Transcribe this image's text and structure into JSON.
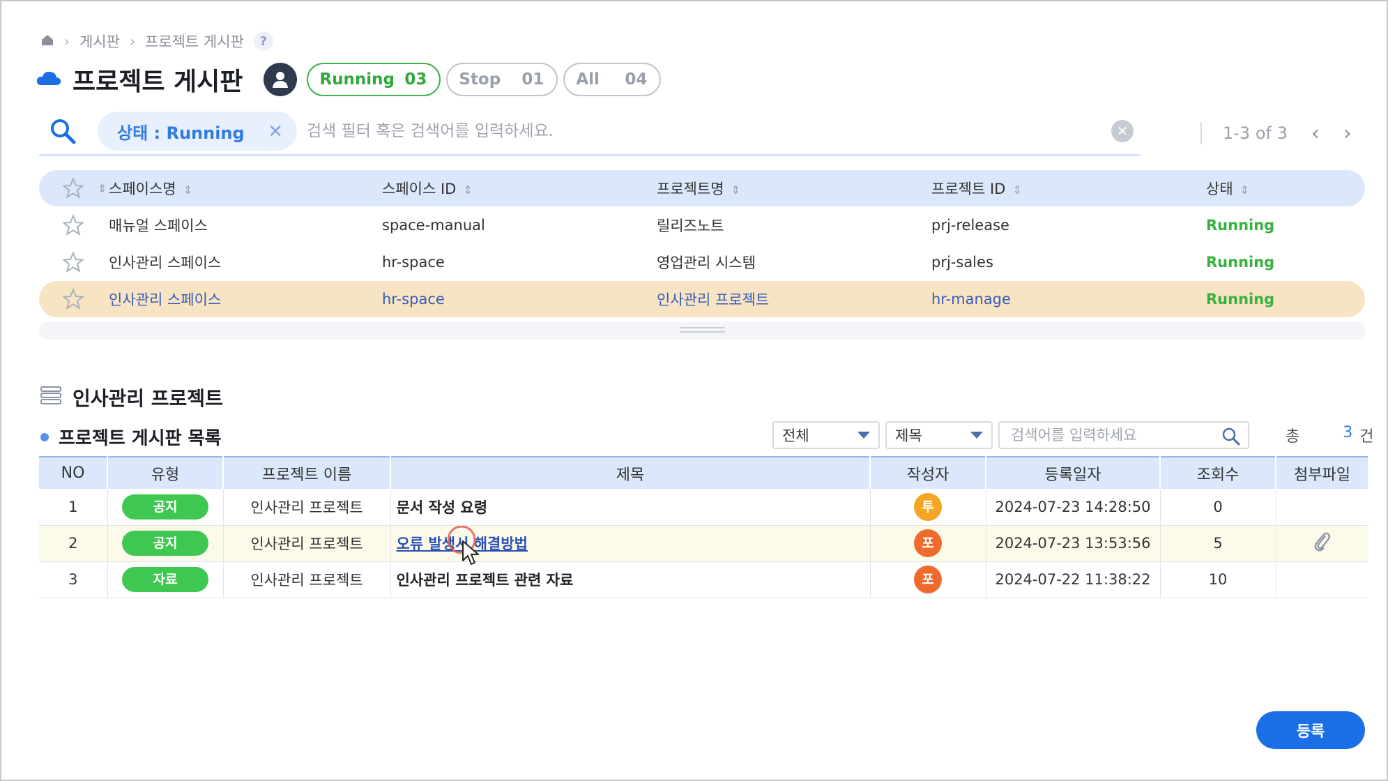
{
  "breadcrumb": {
    "items": [
      "게시판",
      "프로젝트 게시판"
    ],
    "help": "?"
  },
  "header": {
    "title": "프로젝트 게시판",
    "filters": [
      {
        "label": "Running",
        "count": "03"
      },
      {
        "label": "Stop",
        "count": "01"
      },
      {
        "label": "All",
        "count": "04"
      }
    ]
  },
  "search": {
    "chip": "상태 : Running",
    "placeholder": "검색 필터 혹은 검색어를 입력하세요.",
    "pager": "1-3 of 3"
  },
  "space_table": {
    "columns": [
      "스페이스명",
      "스페이스 ID",
      "프로젝트명",
      "프로젝트 ID",
      "상태"
    ],
    "rows": [
      [
        "매뉴얼 스페이스",
        "space-manual",
        "릴리즈노트",
        "prj-release",
        "Running"
      ],
      [
        "인사관리 스페이스",
        "hr-space",
        "영업관리 시스템",
        "prj-sales",
        "Running"
      ],
      [
        "인사관리 스페이스",
        "hr-space",
        "인사관리 프로젝트",
        "hr-manage",
        "Running"
      ]
    ]
  },
  "section": {
    "title": "인사관리 프로젝트",
    "subtitle": "프로젝트 게시판 목록"
  },
  "toolbar": {
    "select1": "전체",
    "select2": "제목",
    "search_placeholder": "검색어를 입력하세요",
    "total_label": "총",
    "total_count": "3",
    "total_unit": "건"
  },
  "board": {
    "columns": [
      "NO",
      "유형",
      "프로젝트 이름",
      "제목",
      "작성자",
      "등록일자",
      "조회수",
      "첨부파일"
    ],
    "rows": [
      {
        "no": "1",
        "type": "공지",
        "project": "인사관리 프로젝트",
        "title": "문서 작성 요령",
        "author": "투",
        "date": "2024-07-23 14:28:50",
        "views": "0"
      },
      {
        "no": "2",
        "type": "공지",
        "project": "인사관리 프로젝트",
        "title": "오류 발생시 해결방법",
        "author": "포",
        "date": "2024-07-23 13:53:56",
        "views": "5"
      },
      {
        "no": "3",
        "type": "자료",
        "project": "인사관리 프로젝트",
        "title": "인사관리 프로젝트 관련 자료",
        "author": "포",
        "date": "2024-07-22 11:38:22",
        "views": "10"
      }
    ]
  },
  "actions": {
    "register": "등록"
  },
  "colors": {
    "accent": "#1a6ee6",
    "running": "#35b23f",
    "selected_row": "#f8e3c3"
  }
}
